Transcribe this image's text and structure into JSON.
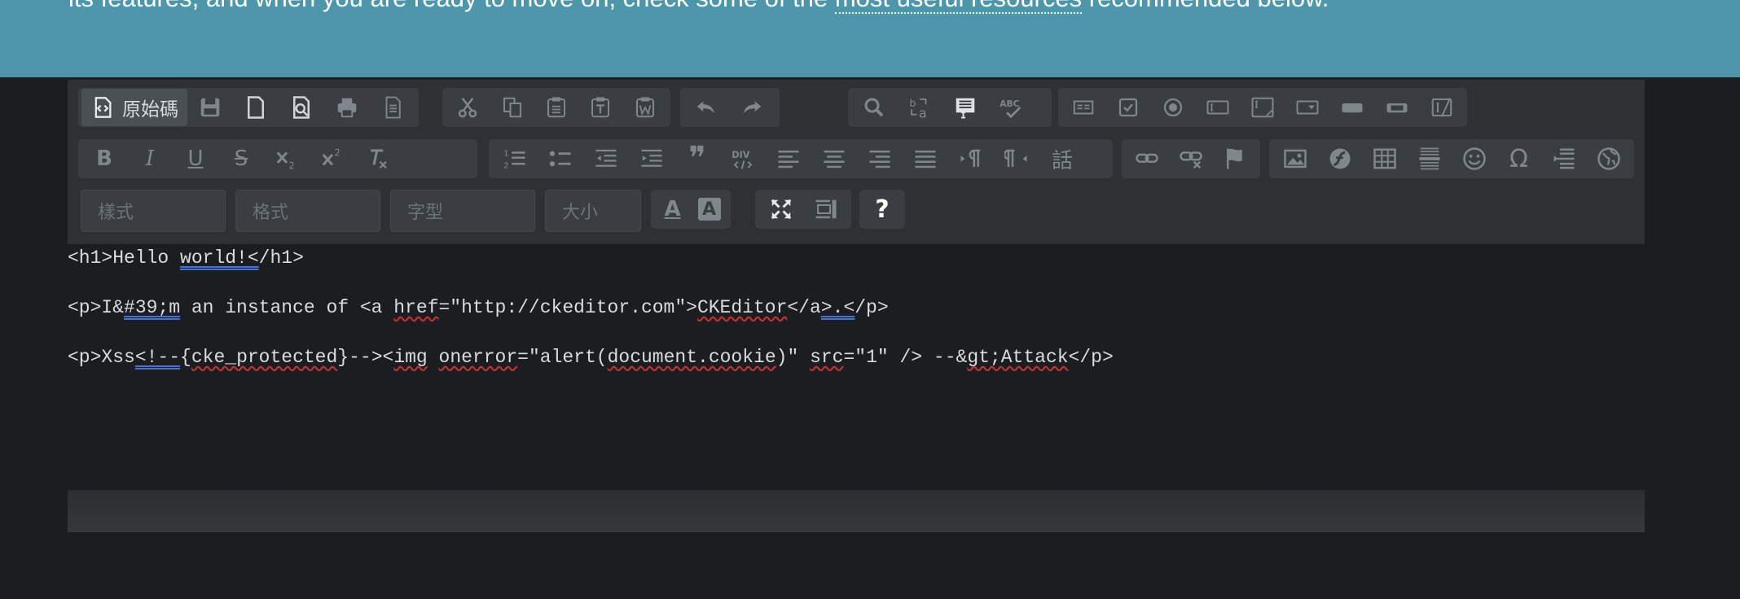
{
  "banner": {
    "text_before": "its features, and when you are ready to move on, check some of the ",
    "link_text": "most useful resources",
    "text_after": " recommended below."
  },
  "toolbar": {
    "source_label": "原始碼",
    "row1_icons": [
      "save-icon",
      "new-page-icon",
      "preview-icon",
      "print-icon",
      "templates-icon",
      "cut-icon",
      "copy-icon",
      "paste-icon",
      "paste-text-icon",
      "paste-word-icon",
      "undo-icon",
      "redo-icon",
      "find-icon",
      "replace-icon",
      "select-all-icon",
      "spellcheck-icon",
      "form-icon",
      "checkbox-icon",
      "radio-icon",
      "textfield-icon",
      "textarea-icon",
      "select-icon",
      "button-icon",
      "image-button-icon",
      "hidden-field-icon"
    ],
    "row2_icons": [
      "bold-icon",
      "italic-icon",
      "underline-icon",
      "strike-icon",
      "subscript-icon",
      "superscript-icon",
      "remove-format-icon",
      "numbered-list-icon",
      "bulleted-list-icon",
      "outdent-icon",
      "indent-icon",
      "blockquote-icon",
      "div-icon",
      "align-left-icon",
      "align-center-icon",
      "align-right-icon",
      "justify-icon",
      "ltr-icon",
      "rtl-icon",
      "language-icon",
      "link-icon",
      "unlink-icon",
      "anchor-icon",
      "image-icon",
      "flash-icon",
      "table-icon",
      "horizontal-rule-icon",
      "smiley-icon",
      "special-char-icon",
      "page-break-icon",
      "iframe-icon"
    ],
    "styles_placeholder": "樣式",
    "format_placeholder": "格式",
    "font_placeholder": "字型",
    "size_placeholder": "大小",
    "row3_icons": [
      "text-color-icon",
      "bg-color-icon",
      "maximize-icon",
      "show-blocks-icon",
      "about-icon"
    ],
    "about_label": "?",
    "bold_label": "B",
    "italic_label": "I",
    "underline_label": "U",
    "strike_label": "S",
    "omega_label": "Ω",
    "language_label": "話",
    "quote_label": "❞",
    "text_color_label": "A",
    "bg_color_label": "A"
  },
  "content": {
    "line1": {
      "a": "<h1>Hello ",
      "b": "world!<",
      "c": "/h1>"
    },
    "line2": {
      "a": "<p>I&",
      "b": "#39;m",
      "c": " an instance of <a ",
      "d": "href",
      "e": "=\"http://ckeditor.com\">",
      "f": "CKEditor",
      "g": "</a",
      "h": ">.<",
      "i": "/p>"
    },
    "line3": {
      "a": "<p>Xss",
      "b": "<!--",
      "c": "{",
      "d": "cke_protected",
      "e": "}--><",
      "f": "img",
      "g": " ",
      "h": "onerror",
      "i": "=\"alert(",
      "j": "document.cookie",
      "k": ")\" ",
      "l": "src",
      "m": "=\"1\" /> --&",
      "n": "gt;Attack",
      "o": "</p>"
    }
  }
}
